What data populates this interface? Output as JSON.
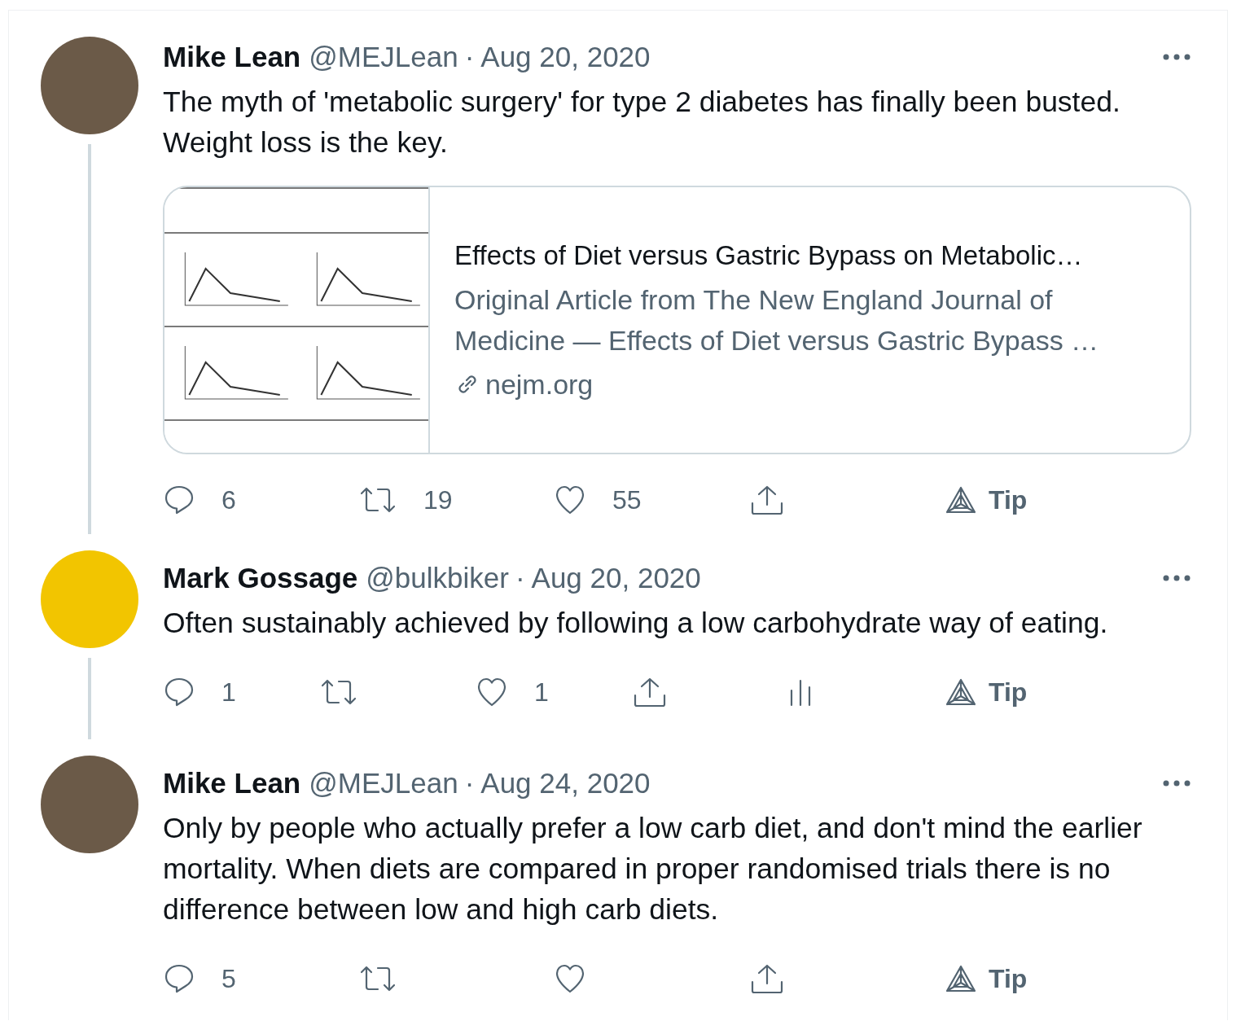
{
  "tweets": [
    {
      "name": "Mike Lean",
      "handle": "@MEJLean",
      "separator": "·",
      "date": "Aug 20, 2020",
      "avatar": {
        "color": "#6b5a48"
      },
      "thread_line": true,
      "text": "The myth of 'metabolic surgery' for type 2 diabetes has finally been busted. Weight loss is the key.",
      "card": {
        "kind": "picture",
        "title": "Effects of Diet versus Gastric Bypass on Metabolic…",
        "description": "Original Article from The New England Journal of Medicine — Effects of Diet versus Gastric Bypass …",
        "domain": "nejm.org"
      },
      "actions": [
        {
          "kind": "reply",
          "count": "6"
        },
        {
          "kind": "retweet",
          "count": "19"
        },
        {
          "kind": "like",
          "count": "55"
        },
        {
          "kind": "share"
        },
        {
          "kind": "tip",
          "label": "Tip"
        }
      ]
    },
    {
      "name": "Mark Gossage",
      "handle": "@bulkbiker",
      "separator": "·",
      "date": "Aug 20, 2020",
      "avatar": {
        "color": "#f2c500"
      },
      "thread_line": true,
      "text": "Often sustainably achieved by following a low carbohydrate way of eating.",
      "actions": [
        {
          "kind": "reply",
          "count": "1"
        },
        {
          "kind": "retweet"
        },
        {
          "kind": "like",
          "count": "1"
        },
        {
          "kind": "share"
        },
        {
          "kind": "analytics"
        },
        {
          "kind": "tip",
          "label": "Tip"
        }
      ]
    },
    {
      "name": "Mike Lean",
      "handle": "@MEJLean",
      "separator": "·",
      "date": "Aug 24, 2020",
      "avatar": {
        "color": "#6b5a48"
      },
      "thread_line": false,
      "text": "Only by people who actually prefer a low carb diet, and don't mind the earlier mortality. When diets are compared in proper randomised trials there is no difference between low and high carb diets.",
      "actions": [
        {
          "kind": "reply",
          "count": "5"
        },
        {
          "kind": "retweet"
        },
        {
          "kind": "like"
        },
        {
          "kind": "share"
        },
        {
          "kind": "tip",
          "label": "Tip"
        }
      ]
    }
  ]
}
